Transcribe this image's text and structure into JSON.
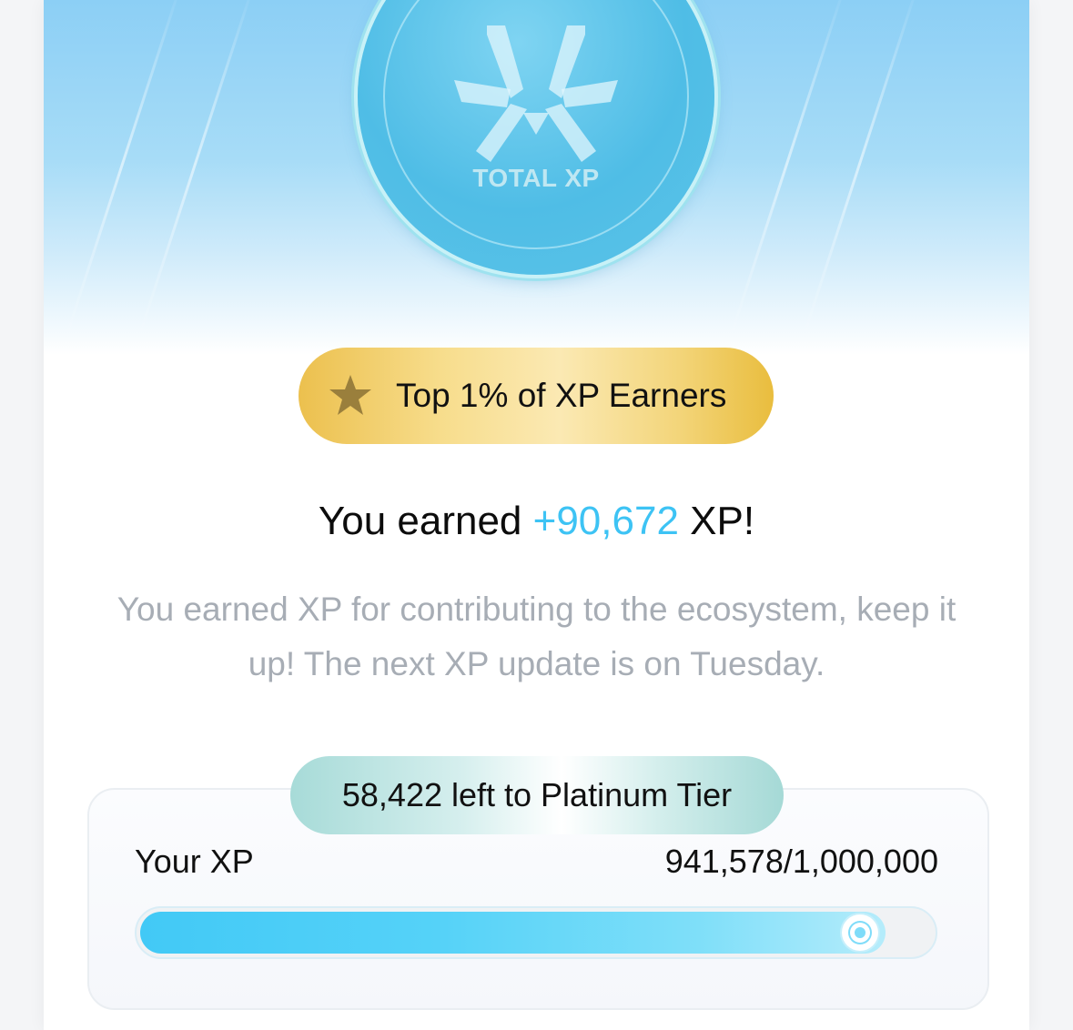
{
  "hero": {
    "coin_label": "TOTAL XP",
    "logo_icon": "xp-logo-icon",
    "colors": {
      "coin": "#4fbde6",
      "sky": "#8ccff5"
    }
  },
  "badge": {
    "icon": "star-icon",
    "text": "Top 1% of XP Earners",
    "color": "#ecc04e"
  },
  "earned": {
    "prefix": "You earned",
    "amount": "+90,672",
    "suffix": "XP!",
    "amount_color": "#3dc3f4"
  },
  "description": "You earned XP for contributing to the ecosystem, keep it up! The next XP update is on Tuesday.",
  "tier": {
    "remaining_label": "58,422 left to Platinum Tier",
    "your_xp_label": "Your XP",
    "xp_value": "941,578/1,000,000",
    "progress_fraction": 0.941578
  }
}
